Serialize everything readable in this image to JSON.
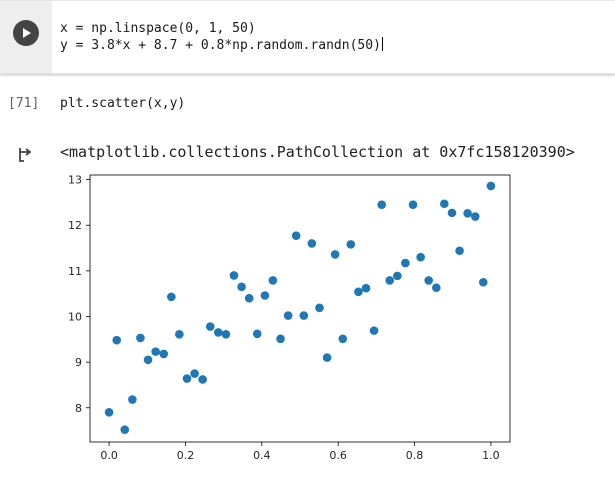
{
  "cell1": {
    "line1": "x = np.linspace(0, 1, 50)",
    "line2": "y = 3.8*x + 8.7 + 0.8*np.random.randn(50)"
  },
  "cell2": {
    "exec_count": "[71]",
    "code": "plt.scatter(x,y)"
  },
  "output": {
    "text": "<matplotlib.collections.PathCollection at 0x7fc158120390>"
  },
  "colors": {
    "marker": "#1f77b4"
  },
  "icons": {
    "run": "play-icon",
    "output": "output-arrow-icon"
  },
  "chart_data": {
    "type": "scatter",
    "xlim": [
      -0.05,
      1.05
    ],
    "ylim": [
      7.25,
      13.1
    ],
    "xticks": [
      0.0,
      0.2,
      0.4,
      0.6,
      0.8,
      1.0
    ],
    "xtick_labels": [
      "0.0",
      "0.2",
      "0.4",
      "0.6",
      "0.8",
      "1.0"
    ],
    "yticks": [
      8,
      9,
      10,
      11,
      12,
      13
    ],
    "ytick_labels": [
      "8",
      "9",
      "10",
      "11",
      "12",
      "13"
    ],
    "grid": false,
    "x": [
      0.0,
      0.02,
      0.041,
      0.061,
      0.082,
      0.102,
      0.122,
      0.143,
      0.163,
      0.184,
      0.204,
      0.224,
      0.245,
      0.265,
      0.286,
      0.306,
      0.327,
      0.347,
      0.367,
      0.388,
      0.408,
      0.429,
      0.449,
      0.469,
      0.49,
      0.51,
      0.531,
      0.551,
      0.571,
      0.592,
      0.612,
      0.633,
      0.653,
      0.673,
      0.694,
      0.714,
      0.735,
      0.755,
      0.776,
      0.796,
      0.816,
      0.837,
      0.857,
      0.878,
      0.898,
      0.918,
      0.939,
      0.959,
      0.98,
      1.0
    ],
    "y": [
      7.9,
      9.48,
      7.52,
      8.18,
      9.53,
      9.05,
      9.23,
      9.18,
      10.43,
      9.61,
      8.64,
      8.75,
      8.62,
      9.78,
      9.65,
      9.61,
      10.9,
      10.65,
      10.4,
      9.62,
      10.46,
      10.79,
      9.51,
      10.02,
      11.77,
      10.02,
      11.6,
      10.19,
      9.1,
      11.36,
      9.51,
      11.58,
      10.54,
      10.62,
      9.69,
      12.45,
      10.79,
      10.89,
      11.17,
      12.45,
      11.3,
      10.79,
      10.63,
      12.47,
      12.27,
      11.44,
      12.26,
      12.19,
      10.75,
      12.86
    ]
  }
}
